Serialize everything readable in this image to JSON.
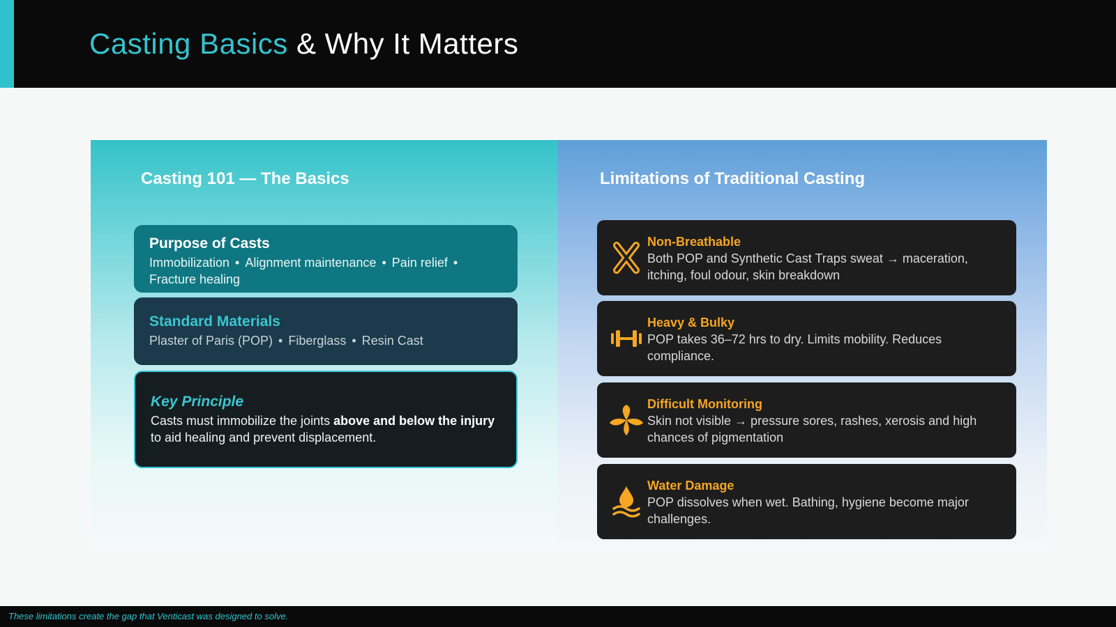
{
  "header": {
    "title_accent": "Casting Basics",
    "title_rest": "& Why It Matters"
  },
  "left": {
    "heading": "Casting 101 — The Basics",
    "purpose": {
      "title": "Purpose of Casts",
      "items": [
        "Immobilization",
        "Alignment maintenance",
        "Pain relief",
        "Fracture healing"
      ]
    },
    "materials": {
      "title": "Standard Materials",
      "items": [
        "Plaster of Paris (POP)",
        "Fiberglass",
        "Resin Cast"
      ]
    },
    "principle": {
      "title": "Key Principle",
      "body_pre": "Casts must immobilize the joints ",
      "body_bold": "above and below the injury",
      "body_post": " to aid healing and prevent displacement."
    }
  },
  "right": {
    "heading": "Limitations of Traditional Casting",
    "cards": [
      {
        "icon": "cross-icon",
        "title": "Non-Breathable",
        "body": "Both POP and Synthetic Cast Traps sweat → maceration, itching, foul odour, skin breakdown"
      },
      {
        "icon": "dumbbell-icon",
        "title": "Heavy & Bulky",
        "body": "POP takes 36–72 hrs to dry. Limits mobility. Reduces compliance."
      },
      {
        "icon": "leaf-icon",
        "title": "Difficult Monitoring",
        "body": "Skin not visible → pressure sores, rashes, xerosis and high chances of pigmentation"
      },
      {
        "icon": "water-drop-icon",
        "title": "Water Damage",
        "body": "POP dissolves when wet. Bathing, hygiene become major challenges."
      }
    ]
  },
  "footer": {
    "text": "These limitations create the gap that Venticast was designed to solve."
  },
  "colors": {
    "accent": "#35c3cf",
    "warning": "#f5a623",
    "header_bg": "#0a0a0a"
  }
}
